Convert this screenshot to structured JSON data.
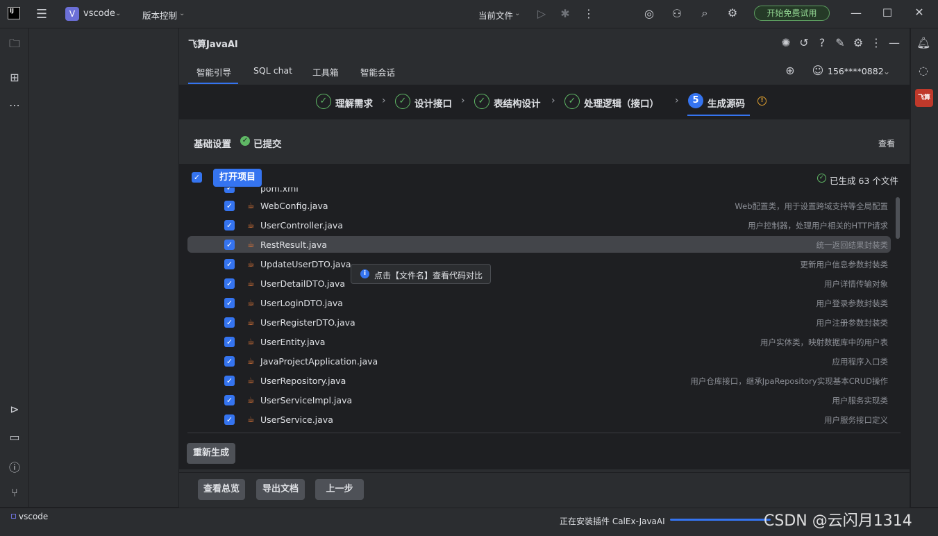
{
  "titlebar": {
    "project_initial": "V",
    "project_name": "vscode",
    "vcs_menu": "版本控制",
    "run_config": "当前文件",
    "trial_button": "开始免费试用"
  },
  "tool": {
    "title": "飞算JavaAI",
    "tabs": [
      "智能引导",
      "SQL chat",
      "工具箱",
      "智能会话"
    ],
    "user": "156****0882",
    "steps": [
      "理解需求",
      "设计接口",
      "表结构设计",
      "处理逻辑（接口）",
      "生成源码"
    ],
    "active_step_number": "5",
    "basic_settings": "基础设置",
    "submitted": "已提交",
    "view_link": "查看",
    "open_project": "打开项目",
    "generated_count": "已生成 63 个文件",
    "partial_first_file": "pom.xml",
    "files": [
      {
        "name": "WebConfig.java",
        "desc": "Web配置类，用于设置跨域支持等全局配置"
      },
      {
        "name": "UserController.java",
        "desc": "用户控制器，处理用户相关的HTTP请求"
      },
      {
        "name": "RestResult.java",
        "desc": "统一返回结果封装类"
      },
      {
        "name": "UpdateUserDTO.java",
        "desc": "更新用户信息参数封装类"
      },
      {
        "name": "UserDetailDTO.java",
        "desc": "用户详情传输对象"
      },
      {
        "name": "UserLoginDTO.java",
        "desc": "用户登录参数封装类"
      },
      {
        "name": "UserRegisterDTO.java",
        "desc": "用户注册参数封装类"
      },
      {
        "name": "UserEntity.java",
        "desc": "用户实体类，映射数据库中的用户表"
      },
      {
        "name": "JavaProjectApplication.java",
        "desc": "应用程序入口类"
      },
      {
        "name": "UserRepository.java",
        "desc": "用户仓库接口，继承JpaRepository实现基本CRUD操作"
      },
      {
        "name": "UserServiceImpl.java",
        "desc": "用户服务实现类"
      },
      {
        "name": "UserService.java",
        "desc": "用户服务接口定义"
      }
    ],
    "tooltip": "点击【文件名】查看代码对比",
    "regenerate": "重新生成",
    "view_overview": "查看总览",
    "export_doc": "导出文档",
    "prev_step": "上一步"
  },
  "statusbar": {
    "project": "vscode",
    "installing": "正在安装插件 CalEx-JavaAI",
    "watermark": "CSDN @云闪月1314"
  },
  "colors": {
    "accent": "#3574f0",
    "success": "#5fb865",
    "background": "#1e1f22",
    "panel": "#2b2d30"
  }
}
